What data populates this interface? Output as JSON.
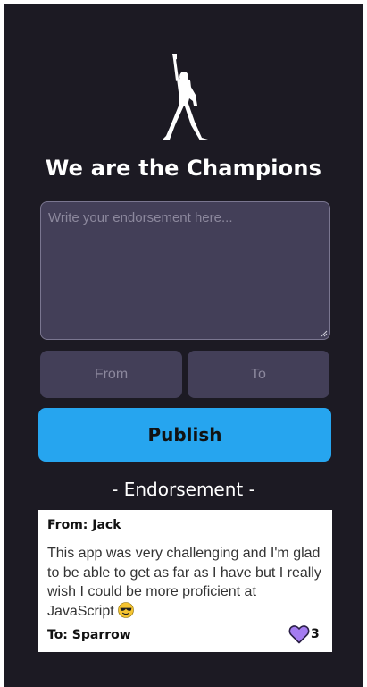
{
  "app": {
    "title": "We are the Champions",
    "logo_icon": "freddie-mercury-silhouette-icon"
  },
  "form": {
    "endorsement_placeholder": "Write your endorsement here...",
    "endorsement_value": "",
    "from_placeholder": "From",
    "to_placeholder": "To",
    "publish_label": "Publish"
  },
  "endorsements": {
    "heading": "- Endorsement -",
    "items": [
      {
        "from": "From: Jack",
        "message": "This app was very challenging and I'm glad to be able to get as far as I have but I really wish I could be more proficient at JavaScript",
        "emoji_icon": "sunglasses-smiley-icon",
        "to": "To: Sparrow",
        "likes": "3",
        "like_icon": "heart-icon"
      }
    ]
  },
  "colors": {
    "background": "#1c1a23",
    "input_fill": "#433f58",
    "accent": "#26a5ef",
    "heart": "#a47cf0"
  }
}
